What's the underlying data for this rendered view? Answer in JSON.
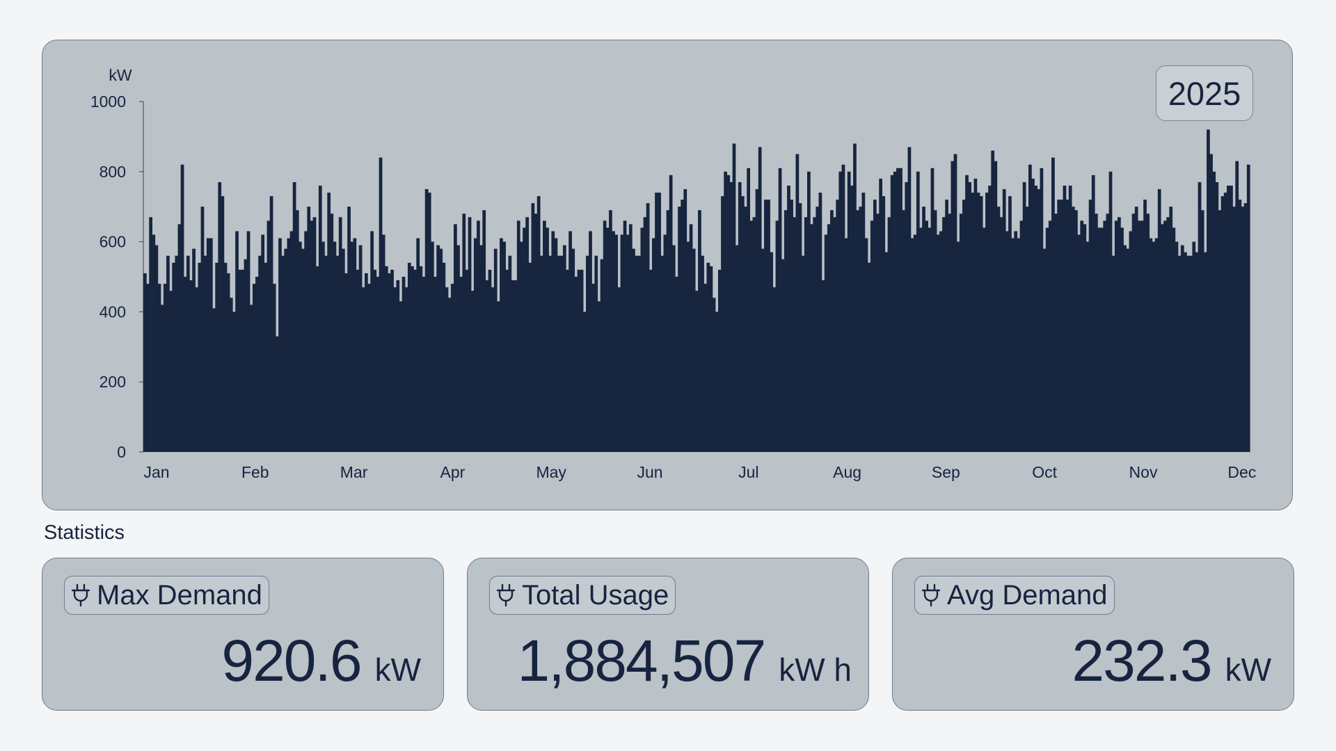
{
  "year": "2025",
  "statistics": {
    "title": "Statistics",
    "cards": [
      {
        "label": "Max Demand",
        "value": "920.6",
        "unit": "kW",
        "icon": "plug-icon"
      },
      {
        "label": "Total Usage",
        "value": "1,884,507",
        "unit": "kW h",
        "icon": "plug-icon"
      },
      {
        "label": "Avg Demand",
        "value": "232.3",
        "unit": "kW",
        "icon": "plug-icon"
      }
    ]
  },
  "chart_data": {
    "type": "bar",
    "title": "",
    "xlabel": "",
    "ylabel": "kW",
    "ylim": [
      0,
      1000
    ],
    "yticks": [
      0,
      200,
      400,
      600,
      800,
      1000
    ],
    "xtick_labels": [
      "Jan",
      "Feb",
      "Mar",
      "Apr",
      "May",
      "Jun",
      "Jul",
      "Aug",
      "Sep",
      "Oct",
      "Nov",
      "Dec"
    ],
    "x_unit": "day",
    "daily_peak_kw": [
      510,
      480,
      670,
      620,
      590,
      480,
      420,
      480,
      560,
      460,
      540,
      560,
      650,
      820,
      500,
      560,
      490,
      580,
      470,
      540,
      700,
      560,
      610,
      610,
      410,
      540,
      770,
      730,
      540,
      510,
      440,
      400,
      630,
      520,
      520,
      550,
      630,
      420,
      480,
      500,
      560,
      620,
      540,
      660,
      730,
      480,
      330,
      610,
      560,
      580,
      610,
      630,
      770,
      690,
      600,
      580,
      630,
      700,
      660,
      670,
      530,
      760,
      600,
      560,
      740,
      680,
      600,
      560,
      670,
      580,
      510,
      700,
      600,
      610,
      520,
      590,
      470,
      510,
      480,
      630,
      520,
      500,
      840,
      620,
      530,
      510,
      520,
      470,
      490,
      430,
      500,
      470,
      540,
      530,
      520,
      610,
      530,
      500,
      750,
      740,
      600,
      500,
      590,
      580,
      540,
      470,
      440,
      480,
      650,
      590,
      500,
      680,
      520,
      670,
      460,
      610,
      660,
      590,
      690,
      490,
      520,
      470,
      580,
      430,
      610,
      600,
      520,
      560,
      490,
      490,
      660,
      600,
      640,
      670,
      540,
      710,
      680,
      730,
      560,
      660,
      640,
      560,
      630,
      610,
      560,
      560,
      590,
      520,
      630,
      580,
      500,
      520,
      520,
      400,
      560,
      630,
      480,
      560,
      430,
      550,
      660,
      640,
      690,
      630,
      620,
      470,
      620,
      660,
      620,
      650,
      580,
      560,
      560,
      640,
      670,
      710,
      520,
      610,
      740,
      740,
      560,
      620,
      690,
      790,
      590,
      500,
      700,
      720,
      750,
      600,
      650,
      580,
      460,
      690,
      560,
      480,
      540,
      530,
      440,
      400,
      520,
      730,
      800,
      790,
      770,
      880,
      590,
      770,
      730,
      700,
      810,
      660,
      670,
      750,
      870,
      580,
      720,
      720,
      570,
      470,
      660,
      810,
      550,
      690,
      760,
      720,
      670,
      850,
      710,
      560,
      670,
      800,
      650,
      670,
      700,
      740,
      490,
      620,
      650,
      690,
      670,
      720,
      800,
      820,
      610,
      800,
      760,
      880,
      690,
      700,
      740,
      610,
      540,
      660,
      720,
      680,
      780,
      730,
      570,
      670,
      790,
      800,
      810,
      810,
      690,
      770,
      870,
      610,
      620,
      800,
      640,
      700,
      660,
      640,
      810,
      690,
      620,
      630,
      670,
      720,
      680,
      830,
      850,
      600,
      680,
      720,
      790,
      770,
      740,
      780,
      740,
      730,
      640,
      740,
      760,
      860,
      830,
      700,
      670,
      750,
      630,
      730,
      610,
      630,
      610,
      660,
      770,
      700,
      820,
      780,
      760,
      750,
      810,
      580,
      640,
      660,
      840,
      680,
      720,
      720,
      760,
      720,
      760,
      700,
      690,
      620,
      660,
      650,
      600,
      720,
      790,
      680,
      640,
      640,
      660,
      680,
      800,
      560,
      660,
      670,
      640,
      590,
      580,
      630,
      680,
      700,
      660,
      660,
      720,
      680,
      610,
      600,
      610,
      750,
      650,
      660,
      670,
      700,
      640,
      600,
      560,
      590,
      570,
      560,
      560,
      600,
      570,
      770,
      690,
      570,
      920,
      850,
      800,
      770,
      690,
      730,
      740,
      760,
      760,
      700,
      830,
      720,
      700,
      710,
      820
    ]
  }
}
